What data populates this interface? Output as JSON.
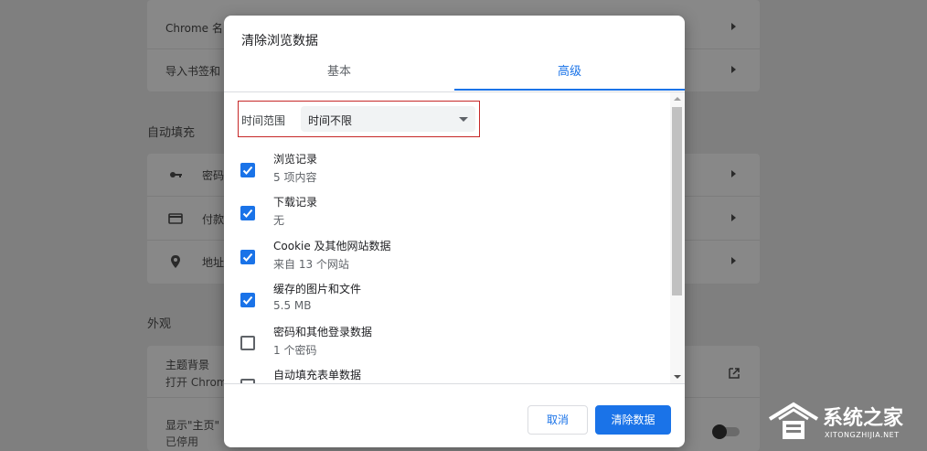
{
  "background": {
    "card1": {
      "rows": [
        {
          "label": "Chrome 名"
        },
        {
          "label": "导入书签和"
        }
      ]
    },
    "autofill": {
      "section_title": "自动填充",
      "rows": [
        {
          "label": "密码",
          "icon": "key-icon"
        },
        {
          "label": "付款",
          "icon": "credit-card-icon"
        },
        {
          "label": "地址",
          "icon": "location-pin-icon"
        }
      ]
    },
    "appearance": {
      "section_title": "外观",
      "theme_label": "主题背景",
      "theme_sub": "打开 Chrom",
      "home_label": "显示\"主页\"",
      "home_sub": "已停用"
    }
  },
  "dialog": {
    "title": "清除浏览数据",
    "tabs": [
      {
        "label": "基本",
        "active": false
      },
      {
        "label": "高级",
        "active": true
      }
    ],
    "time_range": {
      "label": "时间范围",
      "value": "时间不限"
    },
    "items": [
      {
        "label": "浏览记录",
        "sub": "5 项内容",
        "checked": true
      },
      {
        "label": "下载记录",
        "sub": "无",
        "checked": true
      },
      {
        "label": "Cookie 及其他网站数据",
        "sub": "来自 13 个网站",
        "checked": true
      },
      {
        "label": "缓存的图片和文件",
        "sub": "5.5 MB",
        "checked": true
      },
      {
        "label": "密码和其他登录数据",
        "sub": "1 个密码",
        "checked": false
      },
      {
        "label": "自动填充表单数据",
        "sub": "",
        "checked": false
      }
    ],
    "cancel_label": "取消",
    "clear_label": "清除数据"
  },
  "watermark": {
    "cn": "系统之家",
    "en": "XITONGZHIJIA.NET"
  },
  "colors": {
    "accent": "#1a73e8",
    "highlight_border": "#c62828",
    "overlay": "#7f7f7f"
  }
}
